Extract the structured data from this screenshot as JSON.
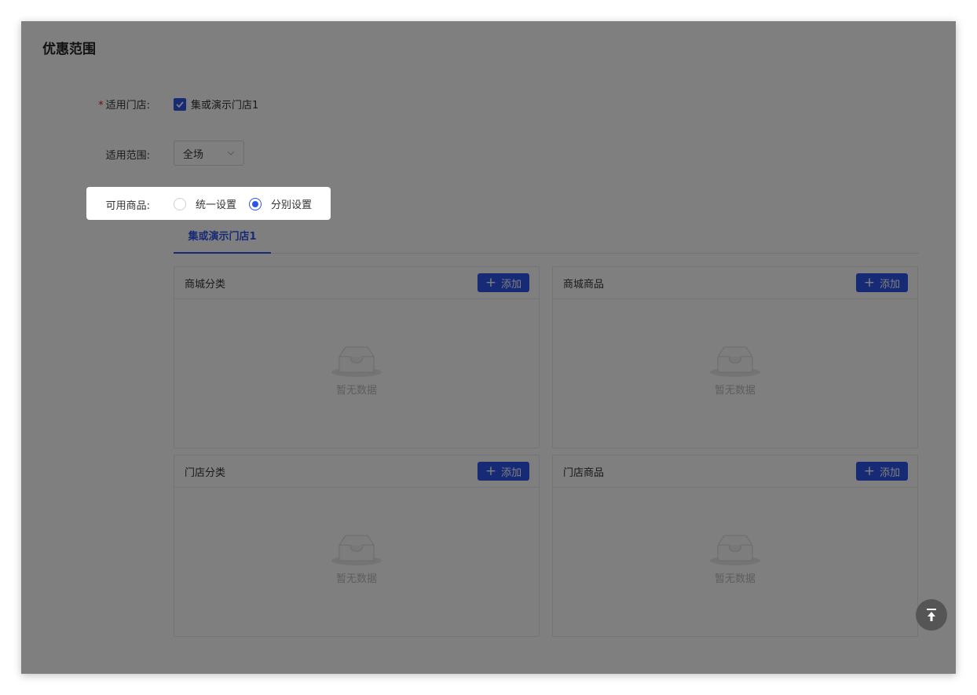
{
  "section": {
    "title": "优惠范围"
  },
  "stores": {
    "label": "适用门店:",
    "required_mark": "*",
    "option": "集或演示门店1",
    "checked": true
  },
  "scope": {
    "label": "适用范围:",
    "value": "全场"
  },
  "goods": {
    "label": "可用商品:",
    "options": [
      {
        "label": "统一设置",
        "checked": false
      },
      {
        "label": "分别设置",
        "checked": true
      }
    ]
  },
  "tabs": [
    {
      "label": "集或演示门店1",
      "active": true
    }
  ],
  "panels": [
    {
      "title": "商城分类",
      "add_label": "添加",
      "empty_text": "暂无数据"
    },
    {
      "title": "商城商品",
      "add_label": "添加",
      "empty_text": "暂无数据"
    },
    {
      "title": "门店分类",
      "add_label": "添加",
      "empty_text": "暂无数据"
    },
    {
      "title": "门店商品",
      "add_label": "添加",
      "empty_text": "暂无数据"
    }
  ],
  "colors": {
    "primary": "#2f54eb",
    "required": "#e02020"
  }
}
